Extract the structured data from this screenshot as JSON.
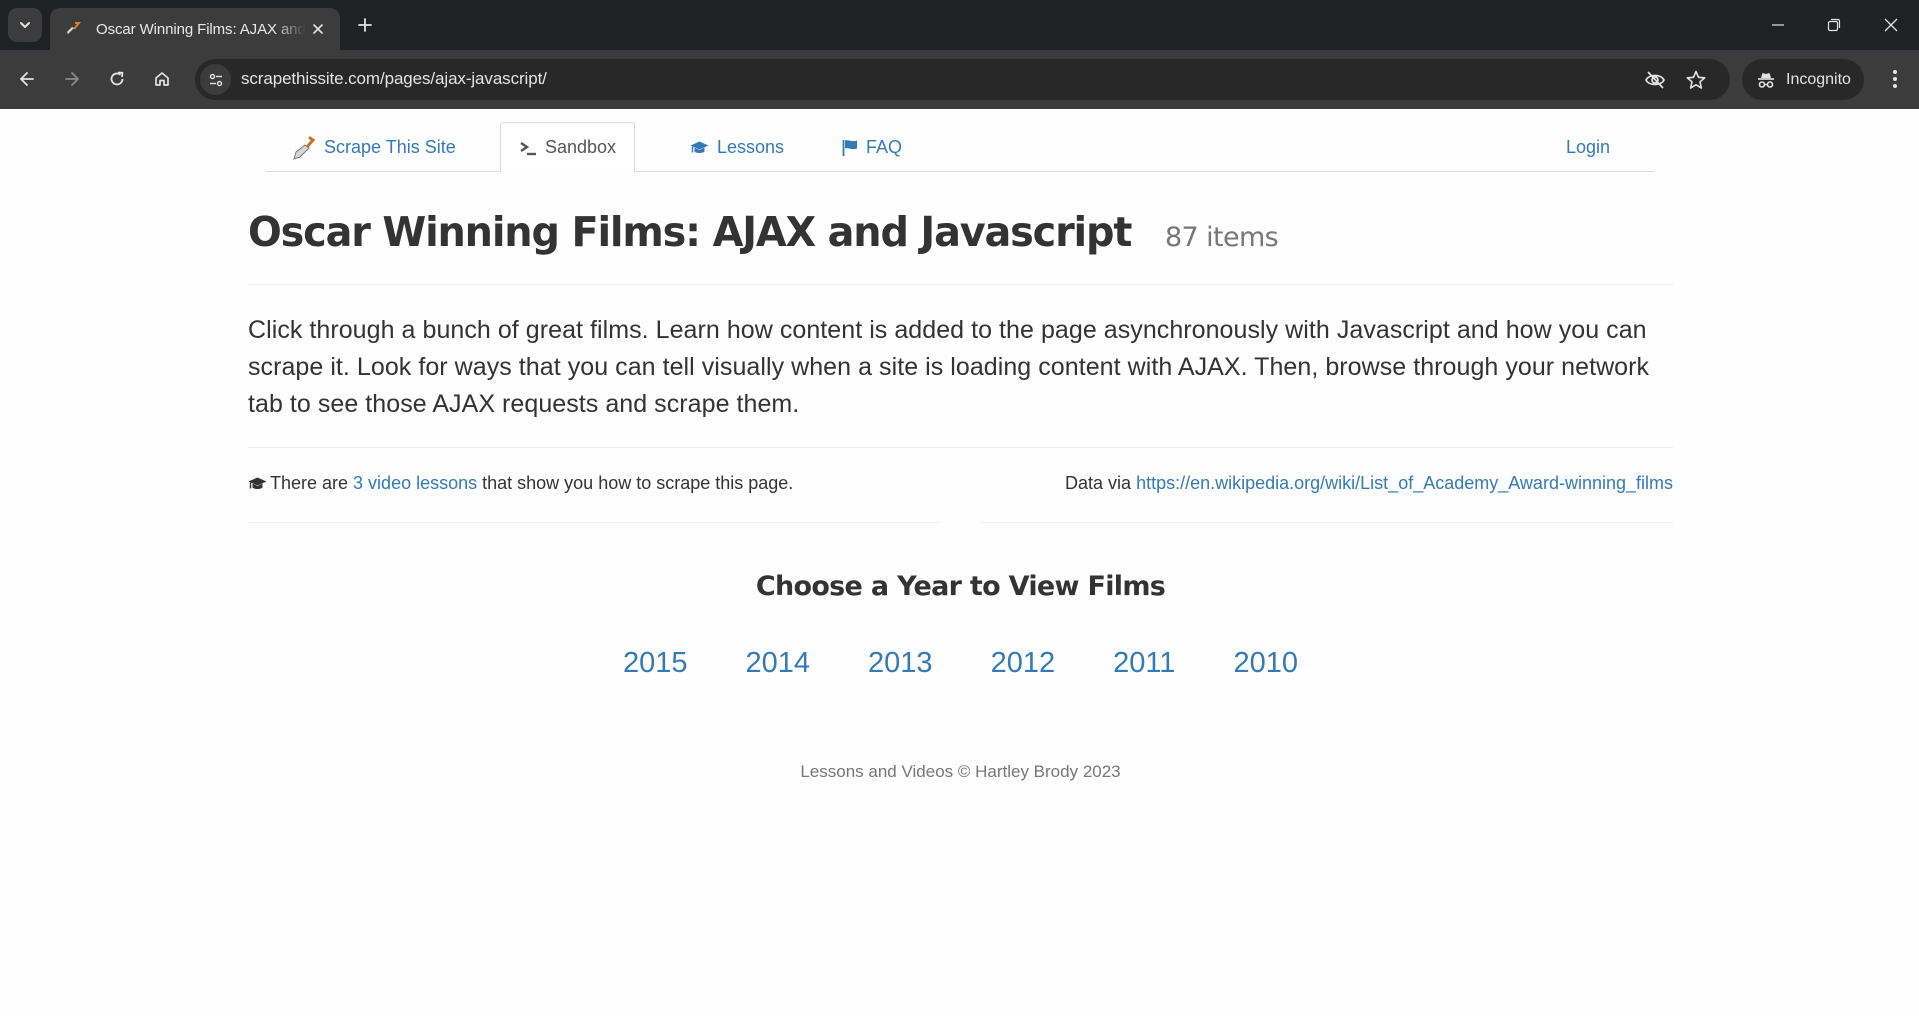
{
  "browser": {
    "tab": {
      "title": "Oscar Winning Films: AJAX and Javascript",
      "favicon": "scraper-icon"
    },
    "url": "scrapethissite.com/pages/ajax-javascript/",
    "incognito_label": "Incognito",
    "icons": {
      "tab_list": "chevron-down-icon",
      "close_tab": "close-icon",
      "new_tab": "plus-icon",
      "back": "arrow-left-icon",
      "forward": "arrow-right-icon",
      "reload": "reload-icon",
      "home": "home-icon",
      "site_info": "tune-icon",
      "tracking": "eye-off-icon",
      "bookmark": "star-icon",
      "menu": "kebab-menu-icon"
    }
  },
  "nav": {
    "items": [
      {
        "label": "Scrape This Site",
        "icon": "scraper-icon",
        "active": false
      },
      {
        "label": "Sandbox",
        "icon": "terminal-icon",
        "active": true
      },
      {
        "label": "Lessons",
        "icon": "graduation-cap-icon",
        "active": false
      },
      {
        "label": "FAQ",
        "icon": "flag-icon",
        "active": false
      }
    ],
    "login": "Login"
  },
  "header": {
    "title": "Oscar Winning Films: AJAX and Javascript",
    "count": "87 items"
  },
  "lead": "Click through a bunch of great films. Learn how content is added to the page asynchronously with Javascript and how you can scrape it. Look for ways that you can tell visually when a site is loading content with AJAX. Then, browse through your network tab to see those AJAX requests and scrape them.",
  "info": {
    "lessons_prefix": "There are ",
    "lessons_link": "3 video lessons",
    "lessons_suffix": " that show you how to scrape this page.",
    "data_prefix": "Data via ",
    "data_link": "https://en.wikipedia.org/wiki/List_of_Academy_Award-winning_films"
  },
  "years_section": {
    "title": "Choose a Year to View Films",
    "years": [
      "2015",
      "2014",
      "2013",
      "2012",
      "2011",
      "2010"
    ]
  },
  "footer": "Lessons and Videos © Hartley Brody 2023",
  "colors": {
    "link": "#337ab7",
    "text": "#333333",
    "muted": "#777777",
    "chrome_dark": "#202124",
    "chrome_toolbar": "#3c3c3c"
  }
}
